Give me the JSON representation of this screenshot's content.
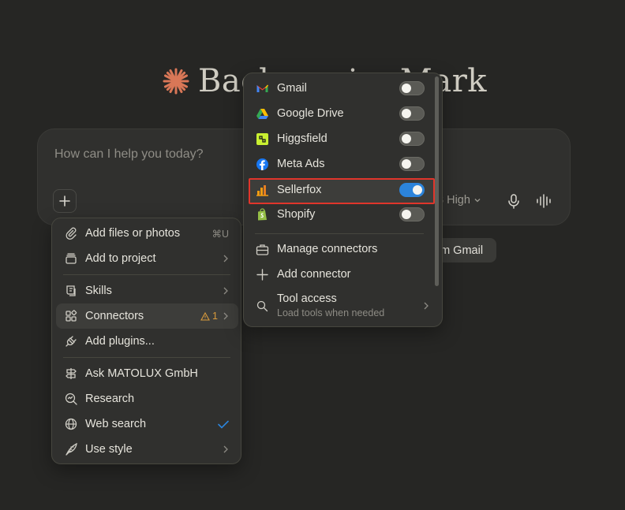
{
  "greeting": {
    "text": "Back again, Mark"
  },
  "composer": {
    "placeholder": "How can I help you today?",
    "model_label": "3 High",
    "suggestion_chip": "om Gmail"
  },
  "left_menu": {
    "items": [
      {
        "label": "Add files or photos",
        "shortcut": "⌘U",
        "icon": "paperclip-icon"
      },
      {
        "label": "Add to project",
        "icon": "project-icon",
        "chevron": true
      },
      {
        "label": "Skills",
        "icon": "skills-icon",
        "chevron": true
      },
      {
        "label": "Connectors",
        "icon": "connectors-icon",
        "warning_count": "1",
        "chevron": true
      },
      {
        "label": "Add plugins...",
        "icon": "plug-icon"
      },
      {
        "label": "Ask MATOLUX GmbH",
        "icon": "signpost-icon"
      },
      {
        "label": "Research",
        "icon": "research-icon"
      },
      {
        "label": "Web search",
        "icon": "globe-icon",
        "checked": true
      },
      {
        "label": "Use style",
        "icon": "quill-icon",
        "chevron": true
      }
    ]
  },
  "connectors_menu": {
    "connectors": [
      {
        "label": "Gmail",
        "icon": "gmail-icon",
        "enabled": false
      },
      {
        "label": "Google Drive",
        "icon": "google-drive-icon",
        "enabled": false
      },
      {
        "label": "Higgsfield",
        "icon": "higgsfield-icon",
        "enabled": false
      },
      {
        "label": "Meta Ads",
        "icon": "facebook-icon",
        "enabled": false
      },
      {
        "label": "Sellerfox",
        "icon": "sellerfox-icon",
        "enabled": true
      },
      {
        "label": "Shopify",
        "icon": "shopify-icon",
        "enabled": false
      }
    ],
    "manage_label": "Manage connectors",
    "add_label": "Add connector",
    "tool_access_label": "Tool access",
    "tool_access_sub": "Load tools when needed"
  },
  "colors": {
    "accent_blue": "#2c84db",
    "highlight_red": "#e0352b",
    "logo_orange": "#d97757",
    "warning": "#d89a3c"
  }
}
